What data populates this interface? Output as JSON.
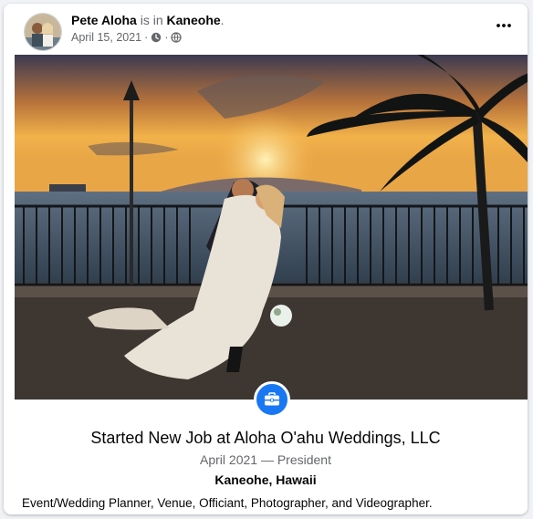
{
  "post": {
    "author": "Pete Aloha",
    "connector": "is in",
    "location": "Kaneohe",
    "date": "April 15, 2021",
    "separator": "·",
    "privacy_icon": "globe-icon",
    "activity_icon": "clock-icon",
    "more_icon": "more-horizontal-icon"
  },
  "life_event": {
    "icon": "briefcase-icon",
    "title": "Started New Job at Aloha O'ahu Weddings, LLC",
    "date_role": "April 2021 — President",
    "location": "Kaneohe, Hawaii",
    "description": "Event/Wedding Planner, Venue, Officiant, Photographer, and Videographer."
  },
  "colors": {
    "accent": "#1877f2",
    "text_primary": "#050505",
    "text_secondary": "#65676b"
  }
}
